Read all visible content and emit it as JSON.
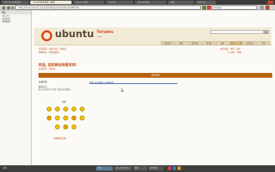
{
  "window": {
    "tabs": [
      {
        "label": "Ubuntu 中文论坛",
        "active": false
      },
      {
        "label": "ubuntu中文论坛 - 发表",
        "active": true
      },
      {
        "label": "Ubuntu 中文",
        "active": false
      },
      {
        "label": "ubuntu",
        "active": false
      },
      {
        "label": "Ubuntu中文",
        "active": false
      },
      {
        "label": "论坛",
        "active": false
      },
      {
        "label": "Ubuntu",
        "active": false
      }
    ]
  },
  "toolbar": {
    "url": "http://forum.ubuntu.org.cn/posting.php?mode=post&f=52",
    "search_text": "Google"
  },
  "sidebar": {
    "header": "书签",
    "items": [
      "Ubuntu",
      "中文论坛",
      "常用链接"
    ]
  },
  "banner": {
    "logo_word": "ubuntu",
    "logo_forums": "forums",
    "logo_org": ".org",
    "search_go": "搜"
  },
  "navtabs": [
    "常见问题",
    "搜索",
    "会员列表",
    "用户组",
    "注册",
    "个人资料",
    "站内短信",
    "登录"
  ],
  "links": {
    "row1_left": "论坛首页 » 综合讨论 » 灌水区",
    "row1_right": "常见问题 · 搜索 · 会员",
    "row2_left": "查看新帖 · 查看未回复",
    "row2_right": "个人资料 · 短信"
  },
  "welcome": "欢迎, 您的新帖将要发表!",
  "breadcrumb": "论坛首页 » 灌水区",
  "section_title": "发表新帖",
  "left_col": {
    "label_subject": "主题标题:",
    "label_msg": "信息正文:",
    "hint": "插入表情符号, 单击下面的表情图标",
    "smiley_heading": "表情",
    "smiley_more": "查看更多表情"
  },
  "right_col": {
    "subject_line": "标题: 在这里输入文章标题"
  },
  "taskbar": {
    "start": "开始",
    "tasks": [
      "Ubuntu中文论坛",
      "终端",
      "文件管理"
    ],
    "status": "完成"
  },
  "colors": {
    "ubuntu_orange": "#dd4814",
    "section_bar": "#b8620c",
    "banner_bg": "#f1ead6"
  }
}
